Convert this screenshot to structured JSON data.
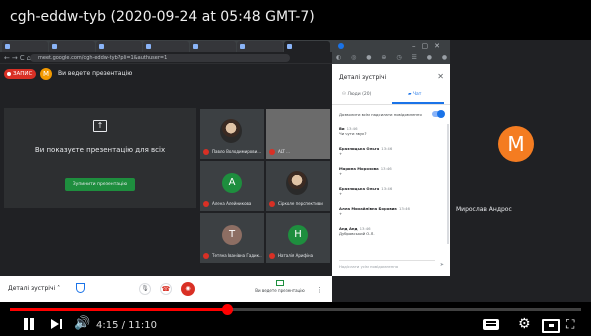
{
  "video": {
    "title": "cgh-eddw-tyb (2020-09-24 at 05:48 GMT-7)",
    "time_display": "4:15 / 11:10",
    "progress_played": 0.38,
    "progress_loaded": 0.39
  },
  "browser": {
    "url": "meet.google.com/cgh-eddw-tyb?pli=1&authuser=1"
  },
  "meet": {
    "recording_label": "ЗАПИС",
    "presenter_initial": "М",
    "presenting_notice": "Ви ведете презентацію",
    "share_text": "Ви показуєте презентацію для всіх",
    "stop_button": "Зупинити презентацію",
    "participants": [
      {
        "name": "Павло Володимирови...",
        "initial": "",
        "color": "#3c4043",
        "photo": true
      },
      {
        "name": "ALT ...",
        "initial": "",
        "color": "#5f6368",
        "photo": false
      },
      {
        "name": "Алена Алейникова",
        "initial": "A",
        "color": "#1e8e3e",
        "photo": false
      },
      {
        "name": "Сірколе перспективи",
        "initial": "",
        "color": "#3c4043",
        "photo": true
      },
      {
        "name": "Тетяна Іванівна Гадик...",
        "initial": "T",
        "color": "#8d6e63",
        "photo": false
      },
      {
        "name": "Наталія Арифіна",
        "initial": "H",
        "color": "#1e8e3e",
        "photo": false
      }
    ],
    "bottom": {
      "details": "Деталі зустрічі",
      "present": "Ви ведете презентацію"
    }
  },
  "panel": {
    "header": "Деталі зустрічі",
    "tab_people": "Люди (20)",
    "tab_chat": "Чат",
    "toggle_text": "Дозволити всім надсилати повідомлення",
    "messages": [
      {
        "who": "Ви",
        "time": "13:46",
        "text": "Чи чути звук?"
      },
      {
        "who": "Бразницька Ольга",
        "time": "13:46",
        "text": "+"
      },
      {
        "who": "Марина Морозова",
        "time": "13:46",
        "text": "+"
      },
      {
        "who": "Бразницька Ольга",
        "time": "13:46",
        "text": "+"
      },
      {
        "who": "Алла Михайлівна Боровик",
        "time": "13:46",
        "text": "+"
      },
      {
        "who": "Анд Анд",
        "time": "13:46",
        "text": "Дубровський О.Л."
      }
    ],
    "compose": "Надіслати усім повідомлення"
  },
  "remote": {
    "initial": "М",
    "name": "Мирослав Андрос",
    "avatar_color": "#f47c21"
  }
}
